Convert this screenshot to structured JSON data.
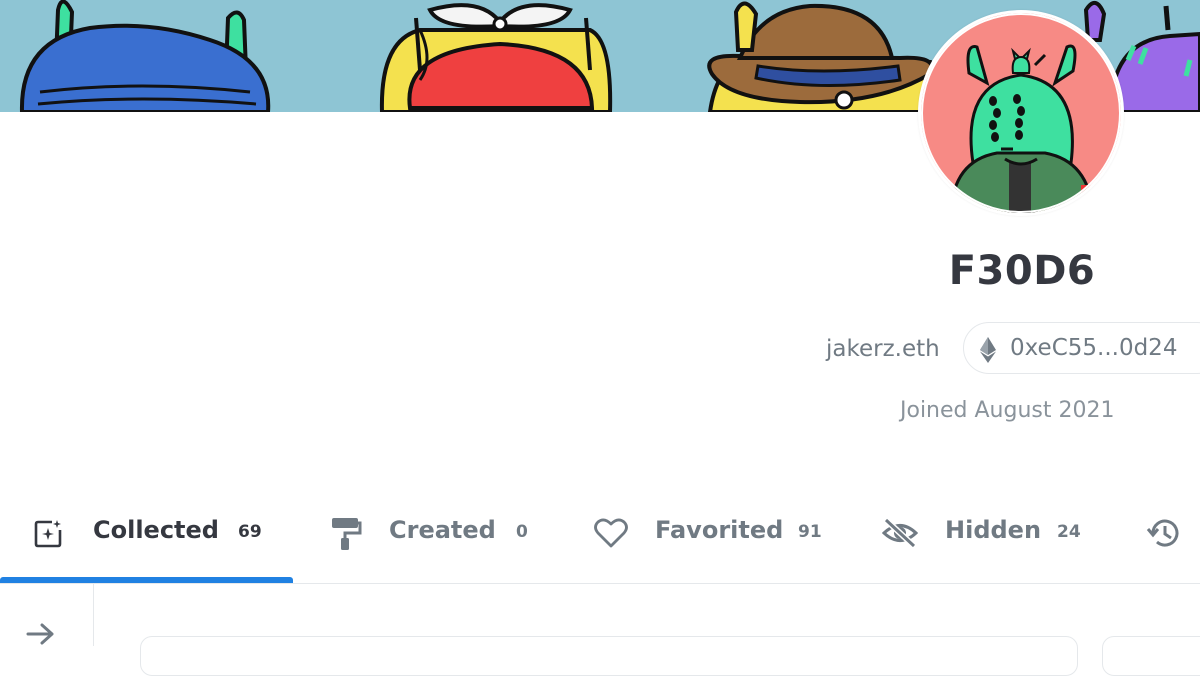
{
  "profile": {
    "username": "F30D6",
    "ens": "jakerz.eth",
    "address": "0xeC55...0d24",
    "joined": "Joined August 2021"
  },
  "tabs": [
    {
      "label": "Collected",
      "count": "69",
      "icon": "collected-icon",
      "active": true
    },
    {
      "label": "Created",
      "count": "0",
      "icon": "paint-roller-icon",
      "active": false
    },
    {
      "label": "Favorited",
      "count": "91",
      "icon": "heart-icon",
      "active": false
    },
    {
      "label": "Hidden",
      "count": "24",
      "icon": "eye-off-icon",
      "active": false
    },
    {
      "label": "",
      "count": "",
      "icon": "history-icon",
      "active": false
    }
  ],
  "colors": {
    "accent": "#2081e2",
    "banner_bg": "#8ec5d4",
    "avatar_bg": "#f78a85",
    "avatar_character": "#3ee0a0",
    "text_primary": "#353840",
    "text_secondary": "#707a83"
  }
}
